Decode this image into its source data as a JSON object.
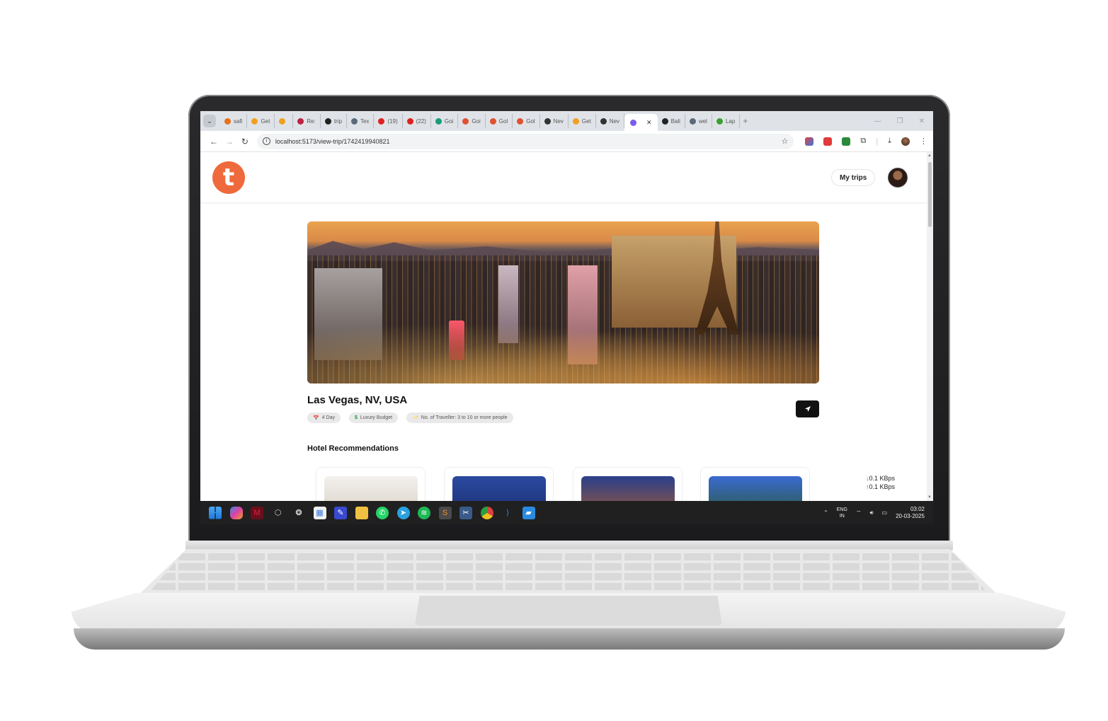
{
  "browser": {
    "tabs": [
      {
        "label": "safi",
        "color": "#e8711a"
      },
      {
        "label": "Get",
        "color": "#f0a020"
      },
      {
        "label": "",
        "color": "#f0a020"
      },
      {
        "label": "Re:",
        "color": "#c02040"
      },
      {
        "label": "trip",
        "color": "#222222"
      },
      {
        "label": "Tex",
        "color": "#5a6a7a"
      },
      {
        "label": "(19)",
        "color": "#e02020"
      },
      {
        "label": "(22)",
        "color": "#e02020"
      },
      {
        "label": "Goi",
        "color": "#1a9a7a"
      },
      {
        "label": "Goi",
        "color": "#e05030"
      },
      {
        "label": "Gol",
        "color": "#e05030"
      },
      {
        "label": "Gol",
        "color": "#e05030"
      },
      {
        "label": "Nev",
        "color": "#333333"
      },
      {
        "label": "Get",
        "color": "#f0a020"
      },
      {
        "label": "Nev",
        "color": "#333333"
      }
    ],
    "active_tab": {
      "label": "",
      "color": "#7a5af0"
    },
    "tabs_after": [
      {
        "label": "Bali",
        "color": "#222222"
      },
      {
        "label": "wel",
        "color": "#5a6a7a"
      },
      {
        "label": "Lap",
        "color": "#3aa030"
      }
    ],
    "url": "localhost:5173/view-trip/1742419940821"
  },
  "header": {
    "logo_letter": "t",
    "my_trips_label": "My trips"
  },
  "trip": {
    "title": "Las Vegas, NV, USA",
    "chips": [
      {
        "icon": "📅",
        "label": "4 Day"
      },
      {
        "icon": "$",
        "label": "Luxury Budget"
      },
      {
        "icon": "🥂",
        "label": "No. of Traveller: 3 to 10 or more people"
      }
    ],
    "section_title": "Hotel Recommendations"
  },
  "netspeed": {
    "down": "0.1 KBps",
    "up": "0.1 KBps"
  },
  "taskbar": {
    "lang_line1": "ENG",
    "lang_line2": "IN",
    "time": "03:02",
    "date": "20-03-2025"
  }
}
